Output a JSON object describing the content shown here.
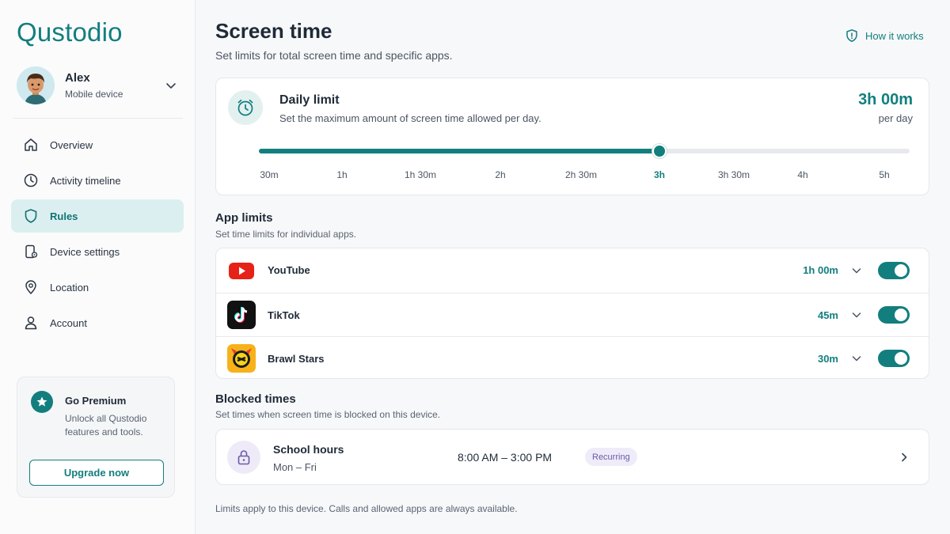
{
  "sidebar": {
    "logo": "Qustodio",
    "profile": {
      "name": "Alex",
      "device": "Mobile device"
    },
    "nav": [
      {
        "label": "Overview",
        "icon": "home-icon",
        "active": false
      },
      {
        "label": "Activity timeline",
        "icon": "clock-icon",
        "active": false
      },
      {
        "label": "Rules",
        "icon": "shield-icon",
        "active": true
      },
      {
        "label": "Device settings",
        "icon": "device-settings-icon",
        "active": false
      },
      {
        "label": "Location",
        "icon": "location-pin-icon",
        "active": false
      },
      {
        "label": "Account",
        "icon": "person-icon",
        "active": false
      }
    ],
    "premium": {
      "title": "Go Premium",
      "description": "Unlock all Qustodio features and tools.",
      "button": "Upgrade now"
    }
  },
  "header": {
    "title": "Screen time",
    "subtitle": "Set limits for total screen time and specific apps.",
    "help_link": "How it works"
  },
  "daily_limit": {
    "title": "Daily limit",
    "description": "Set the maximum amount of screen time allowed per day.",
    "value": "3h 00m",
    "unit": "per day",
    "ticks": [
      "30m",
      "1h",
      "1h 30m",
      "2h",
      "2h 30m",
      "3h",
      "3h 30m",
      "4h",
      "5h"
    ],
    "selected_tick": "3h",
    "slider_fraction": 0.615
  },
  "app_limits": {
    "title": "App limits",
    "subtitle": "Set time limits for individual apps.",
    "apps": [
      {
        "name": "YouTube",
        "time": "1h 00m",
        "enabled": true,
        "icon": "youtube-icon"
      },
      {
        "name": "TikTok",
        "time": "45m",
        "enabled": true,
        "icon": "tiktok-icon"
      },
      {
        "name": "Brawl Stars",
        "time": "30m",
        "enabled": true,
        "icon": "brawl-stars-icon"
      }
    ]
  },
  "blocked_times": {
    "title": "Blocked times",
    "subtitle": "Set times when screen time is blocked on this device.",
    "items": [
      {
        "name": "School hours",
        "days": "Mon – Fri",
        "time": "8:00 AM – 3:00 PM",
        "badge": "Recurring"
      }
    ]
  },
  "footnote": "Limits apply to this device. Calls and allowed apps are always available.",
  "colors": {
    "accent": "#137e7e",
    "active_nav_bg": "#dceff0",
    "badge_purple": "#6b5ba8"
  }
}
